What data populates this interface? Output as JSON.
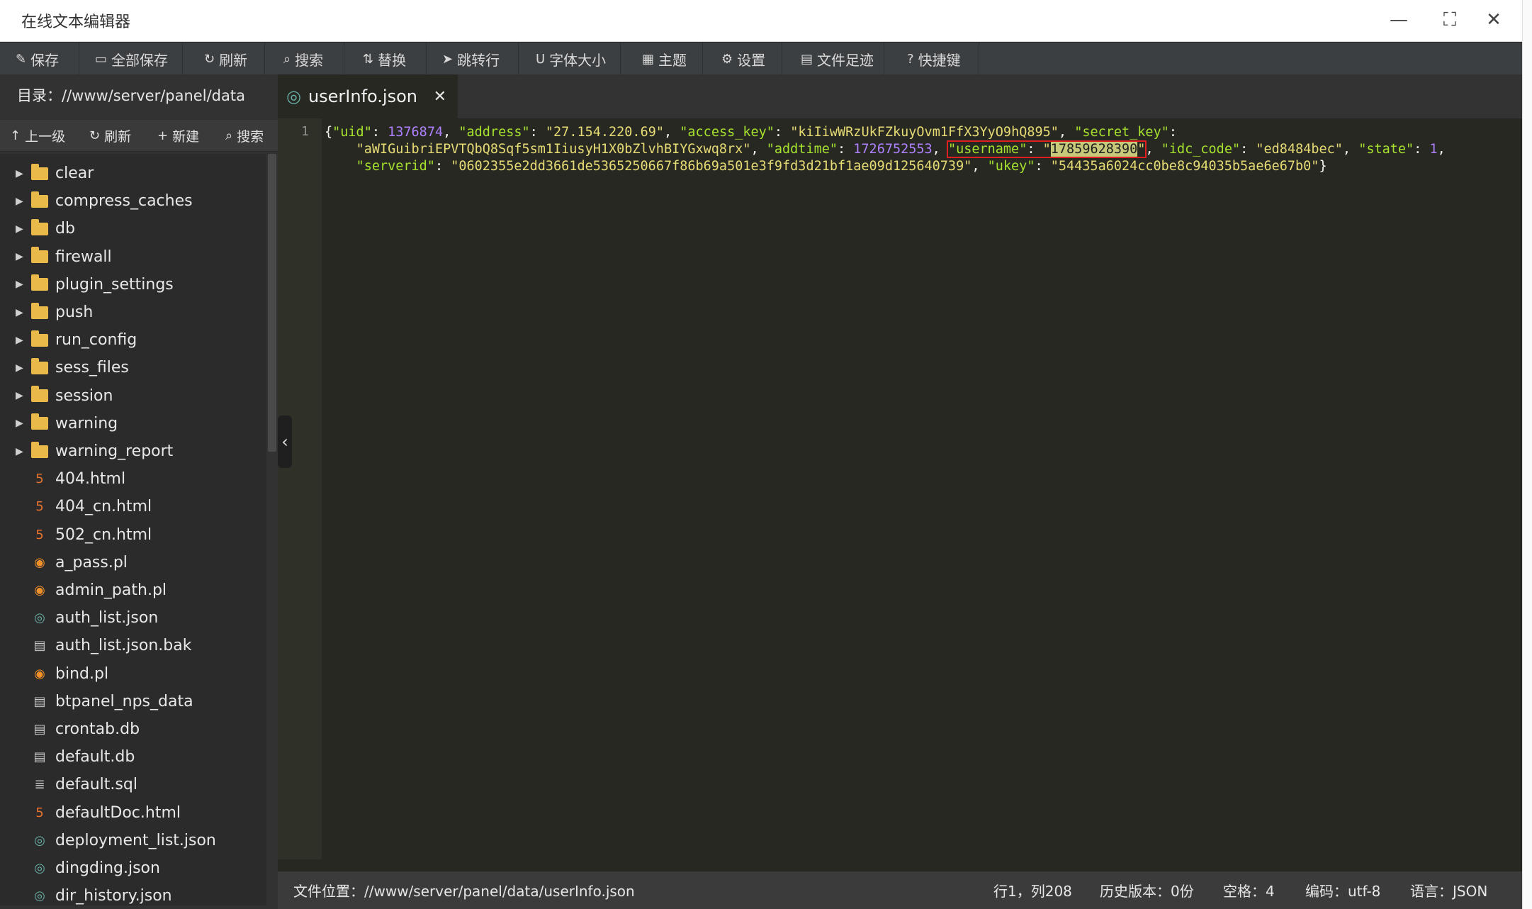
{
  "window": {
    "title": "在线文本编辑器",
    "minimize_icon": "minimize-icon",
    "maximize_icon": "maximize-icon",
    "close_icon": "close-icon"
  },
  "toolbar": {
    "buttons": [
      {
        "label": "保存",
        "icon": "✎"
      },
      {
        "label": "全部保存",
        "icon": "▭"
      },
      {
        "label": "刷新",
        "icon": "↻"
      },
      {
        "label": "搜索",
        "icon": "⌕"
      },
      {
        "label": "替换",
        "icon": "⇅"
      },
      {
        "label": "跳转行",
        "icon": "➤"
      },
      {
        "label": "字体大小",
        "icon": "U"
      },
      {
        "label": "主题",
        "icon": "▦"
      },
      {
        "label": "设置",
        "icon": "⚙"
      },
      {
        "label": "文件足迹",
        "icon": "▤"
      },
      {
        "label": "快捷键",
        "icon": "?"
      }
    ]
  },
  "sidebar": {
    "directory": "目录：//www/server/panel/data",
    "actions": [
      {
        "label": "上一级",
        "icon": "↑"
      },
      {
        "label": "刷新",
        "icon": "↻"
      },
      {
        "label": "新建",
        "icon": "+"
      },
      {
        "label": "搜索",
        "icon": "⌕"
      }
    ],
    "items": [
      {
        "name": "clear",
        "type": "folder"
      },
      {
        "name": "compress_caches",
        "type": "folder"
      },
      {
        "name": "db",
        "type": "folder"
      },
      {
        "name": "firewall",
        "type": "folder"
      },
      {
        "name": "plugin_settings",
        "type": "folder"
      },
      {
        "name": "push",
        "type": "folder"
      },
      {
        "name": "run_config",
        "type": "folder"
      },
      {
        "name": "sess_files",
        "type": "folder"
      },
      {
        "name": "session",
        "type": "folder"
      },
      {
        "name": "warning",
        "type": "folder"
      },
      {
        "name": "warning_report",
        "type": "folder"
      },
      {
        "name": "404.html",
        "type": "html"
      },
      {
        "name": "404_cn.html",
        "type": "html"
      },
      {
        "name": "502_cn.html",
        "type": "html"
      },
      {
        "name": "a_pass.pl",
        "type": "perl"
      },
      {
        "name": "admin_path.pl",
        "type": "perl"
      },
      {
        "name": "auth_list.json",
        "type": "json"
      },
      {
        "name": "auth_list.json.bak",
        "type": "text"
      },
      {
        "name": "bind.pl",
        "type": "perl"
      },
      {
        "name": "btpanel_nps_data",
        "type": "text"
      },
      {
        "name": "crontab.db",
        "type": "text"
      },
      {
        "name": "default.db",
        "type": "text"
      },
      {
        "name": "default.sql",
        "type": "sql"
      },
      {
        "name": "defaultDoc.html",
        "type": "html"
      },
      {
        "name": "deployment_list.json",
        "type": "json"
      },
      {
        "name": "dingding.json",
        "type": "json"
      },
      {
        "name": "dir_history.json",
        "type": "json"
      }
    ]
  },
  "editor": {
    "tab_label": "userInfo.json",
    "line_number": "1",
    "json": {
      "uid": "1376874",
      "address": "27.154.220.69",
      "access_key": "kiIiwWRzUkFZkuyOvm1FfX3YyO9hQ895",
      "secret_key": "aWIGuibriEPVTQbQ8Sqf5sm1IiusyH1X0bZlvhBIYGxwq8rx",
      "addtime": "1726752553",
      "username": "17859628390",
      "idc_code": "ed8484bec",
      "state": "1",
      "serverid": "0602355e2dd3661de5365250667f86b69a501e3f9fd3d21bf1ae09d125640739",
      "ukey": "54435a6024cc0be8c94035b5ae6e67b0"
    }
  },
  "statusbar": {
    "file_location": "文件位置：//www/server/panel/data/userInfo.json",
    "cursor": "行1，列208",
    "history": "历史版本：0份",
    "indent": "空格：4",
    "encoding": "编码：utf-8",
    "language": "语言：JSON"
  },
  "colors": {
    "toolbar_bg": "#3c3f41",
    "editor_bg": "#272822",
    "key_color": "#a6e22e",
    "string_color": "#e6db74",
    "number_color": "#ae81ff",
    "folder_color": "#e9b949",
    "highlight_border": "#e02020"
  }
}
